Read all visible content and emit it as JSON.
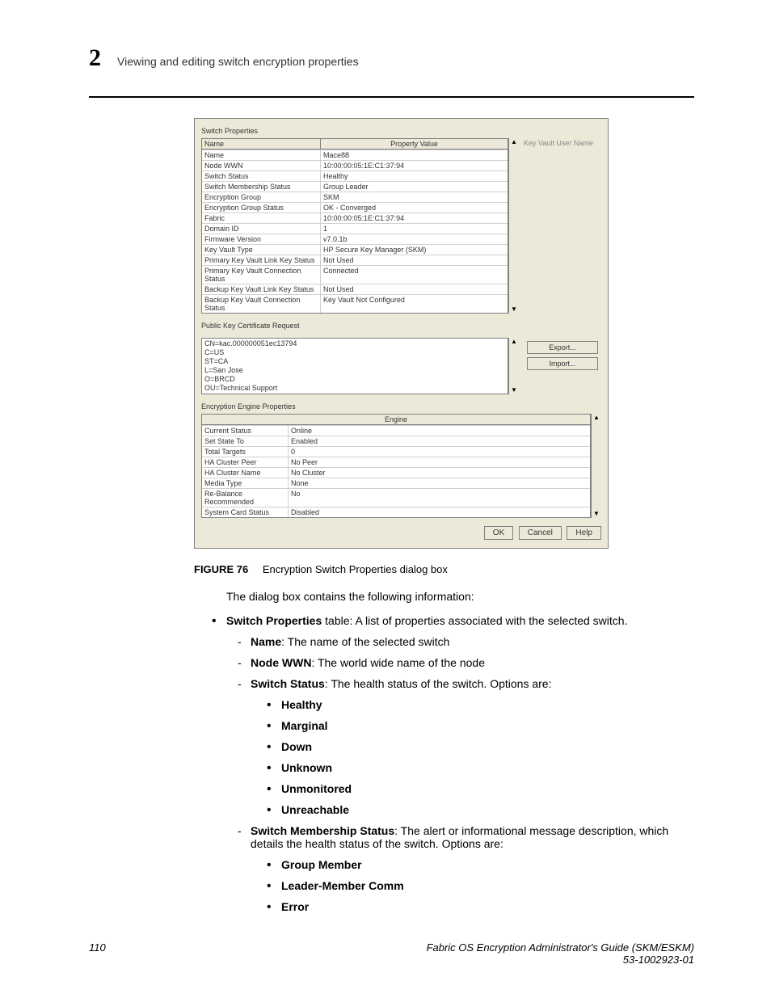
{
  "header": {
    "chapter_number": "2",
    "chapter_title": "Viewing and editing switch encryption properties"
  },
  "dialog": {
    "switch_properties_label": "Switch Properties",
    "name_header": "Name",
    "property_value_header": "Property Value",
    "key_vault_user_label": "Key Vault User Name",
    "rows": [
      {
        "label": "Name",
        "value": "Mace88"
      },
      {
        "label": "Node WWN",
        "value": "10:00:00:05:1E:C1:37:94"
      },
      {
        "label": "Switch Status",
        "value": "Healthy"
      },
      {
        "label": "Switch Membership Status",
        "value": "Group Leader"
      },
      {
        "label": "Encryption Group",
        "value": "SKM"
      },
      {
        "label": "Encryption Group Status",
        "value": "OK - Converged"
      },
      {
        "label": "Fabric",
        "value": "10:00:00:05:1E:C1:37:94"
      },
      {
        "label": "Domain ID",
        "value": "1"
      },
      {
        "label": "Firmware Version",
        "value": "v7.0.1b"
      },
      {
        "label": "Key Vault Type",
        "value": "HP Secure Key Manager (SKM)"
      },
      {
        "label": "Primary Key Vault Link Key Status",
        "value": "Not Used"
      },
      {
        "label": "Primary Key Vault Connection Status",
        "value": "Connected"
      },
      {
        "label": "Backup Key Vault Link Key Status",
        "value": "Not Used"
      },
      {
        "label": "Backup Key Vault Connection Status",
        "value": "Key Vault Not Configured"
      }
    ],
    "cert_label": "Public Key Certificate Request",
    "cert_lines": {
      "l1": "CN=kac.000000051ec13794",
      "l2": "C=US",
      "l3": "ST=CA",
      "l4": "L=San Jose",
      "l5": "O=BRCD",
      "l6": "OU=Technical Support"
    },
    "export_btn": "Export...",
    "import_btn": "Import...",
    "ee_label": "Encryption Engine Properties",
    "ee_header": "Engine",
    "ee_rows": [
      {
        "label": "Current Status",
        "value": "Online"
      },
      {
        "label": "Set State To",
        "value": "Enabled"
      },
      {
        "label": "Total Targets",
        "value": "0"
      },
      {
        "label": "HA Cluster Peer",
        "value": "No Peer"
      },
      {
        "label": "HA Cluster Name",
        "value": "No Cluster"
      },
      {
        "label": "Media Type",
        "value": "None"
      },
      {
        "label": "Re-Balance Recommended",
        "value": "No"
      },
      {
        "label": "System Card Status",
        "value": "Disabled"
      }
    ],
    "ok_btn": "OK",
    "cancel_btn": "Cancel",
    "help_btn": "Help"
  },
  "figure": {
    "label": "FIGURE 76",
    "caption": "Encryption Switch Properties dialog box"
  },
  "body": {
    "intro": "The dialog box contains the following information:",
    "sp_intro_bold": "Switch Properties",
    "sp_intro_rest": " table: A list of properties associated with the selected switch.",
    "name_bold": "Name",
    "name_rest": ": The name of the selected switch",
    "nodewwn_bold": "Node WWN",
    "nodewwn_rest": ": The world wide name of the node",
    "ss_bold": "Switch Status",
    "ss_rest": ": The health status of the switch. Options are:",
    "ss_opts": {
      "o1": "Healthy",
      "o2": "Marginal",
      "o3": "Down",
      "o4": "Unknown",
      "o5": "Unmonitored",
      "o6": "Unreachable"
    },
    "sms_bold": "Switch Membership Status",
    "sms_rest": ": The alert or informational message description, which details the health status of the switch. Options are:",
    "sms_opts": {
      "o1": "Group Member",
      "o2": "Leader-Member Comm",
      "o3": "Error"
    }
  },
  "footer": {
    "page": "110",
    "title": "Fabric OS Encryption Administrator's Guide (SKM/ESKM)",
    "docnum": "53-1002923-01"
  }
}
